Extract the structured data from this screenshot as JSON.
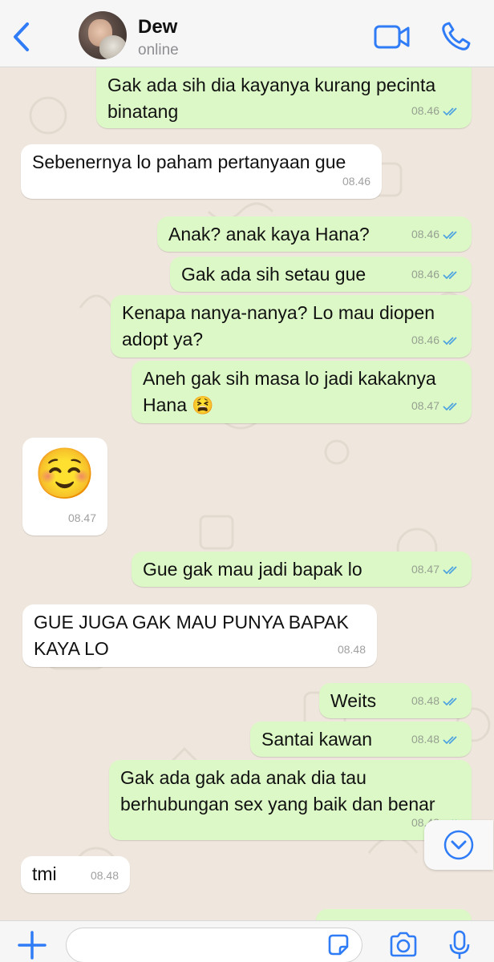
{
  "header": {
    "contact_name": "Dew",
    "contact_status": "online"
  },
  "colors": {
    "accent": "#2f7cf6",
    "outgoing_bubble": "#dcf8c6",
    "incoming_bubble": "#ffffff",
    "read_ticks": "#4fa3e0",
    "chat_background": "#efe7dd"
  },
  "messages": [
    {
      "direction": "out",
      "text": "Gak ada sih dia kayanya kurang pecinta binatang",
      "time": "08.46",
      "read": true
    },
    {
      "direction": "in",
      "text": "Sebenernya lo paham pertanyaan gue",
      "time": "08.46"
    },
    {
      "direction": "out",
      "text": "Anak? anak kaya Hana?",
      "time": "08.46",
      "read": true
    },
    {
      "direction": "out",
      "text": "Gak ada sih setau gue",
      "time": "08.46",
      "read": true
    },
    {
      "direction": "out",
      "text": "Kenapa nanya-nanya? Lo mau diopen adopt ya?",
      "time": "08.46",
      "read": true
    },
    {
      "direction": "out",
      "text": "Aneh gak sih masa lo jadi kakaknya Hana",
      "emoji": "😫",
      "time": "08.47",
      "read": true
    },
    {
      "direction": "in",
      "emoji": "☺️",
      "time": "08.47"
    },
    {
      "direction": "out",
      "text": "Gue gak mau jadi bapak lo",
      "time": "08.47",
      "read": true
    },
    {
      "direction": "in",
      "text": "GUE JUGA GAK MAU PUNYA BAPAK KAYA LO",
      "time": "08.48"
    },
    {
      "direction": "out",
      "text": "Weits",
      "time": "08.48",
      "read": true
    },
    {
      "direction": "out",
      "text": "Santai kawan",
      "time": "08.48",
      "read": true
    },
    {
      "direction": "out",
      "text": "Gak ada gak ada anak dia tau berhubungan sex yang baik dan benar",
      "time": "08.48",
      "read": true
    },
    {
      "direction": "in",
      "text": "tmi",
      "time": "08.48"
    }
  ],
  "input": {
    "placeholder": ""
  },
  "icons": {
    "back": "chevron-left-icon",
    "video_call": "video-camera-icon",
    "voice_call": "phone-icon",
    "scroll_down": "chevron-down-circle-icon",
    "attach": "plus-icon",
    "sticker": "sticker-icon",
    "camera": "camera-icon",
    "mic": "microphone-icon"
  }
}
